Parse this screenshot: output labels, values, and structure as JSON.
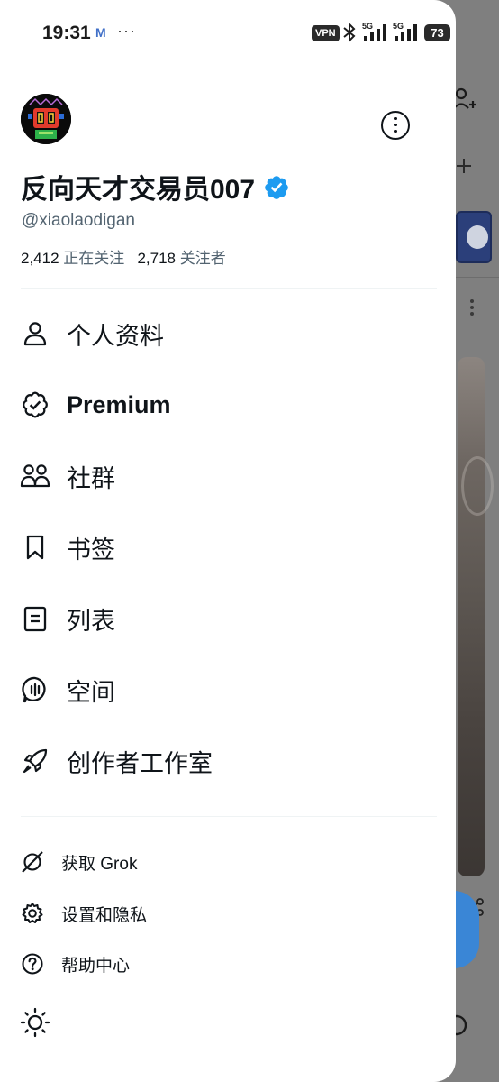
{
  "status_bar": {
    "time": "19:31",
    "mail_badge": "M",
    "overflow_dots": "···",
    "vpn": "VPN",
    "signal_1_label": "5G",
    "signal_2_label": "5G",
    "battery": "73"
  },
  "profile": {
    "display_name": "反向天才交易员007",
    "handle": "@xiaolaodigan",
    "following_count": "2,412",
    "following_label": "正在关注",
    "followers_count": "2,718",
    "followers_label": "关注者",
    "verified_color": "#1d9bf0"
  },
  "menu": {
    "items": [
      {
        "label": "个人资料",
        "icon": "person-icon"
      },
      {
        "label": "Premium",
        "icon": "verified-badge-icon"
      },
      {
        "label": "社群",
        "icon": "communities-icon"
      },
      {
        "label": "书签",
        "icon": "bookmark-icon"
      },
      {
        "label": "列表",
        "icon": "list-icon"
      },
      {
        "label": "空间",
        "icon": "spaces-icon"
      },
      {
        "label": "创作者工作室",
        "icon": "rocket-icon"
      }
    ],
    "secondary": [
      {
        "label": "获取 Grok",
        "icon": "grok-icon"
      },
      {
        "label": "设置和隐私",
        "icon": "gear-icon"
      },
      {
        "label": "帮助中心",
        "icon": "help-icon"
      }
    ],
    "theme_icon": "sun-icon"
  },
  "colors": {
    "text_primary": "#0f1419",
    "text_secondary": "#536471",
    "accent": "#1d9bf0",
    "fab": "#3a86d6"
  }
}
